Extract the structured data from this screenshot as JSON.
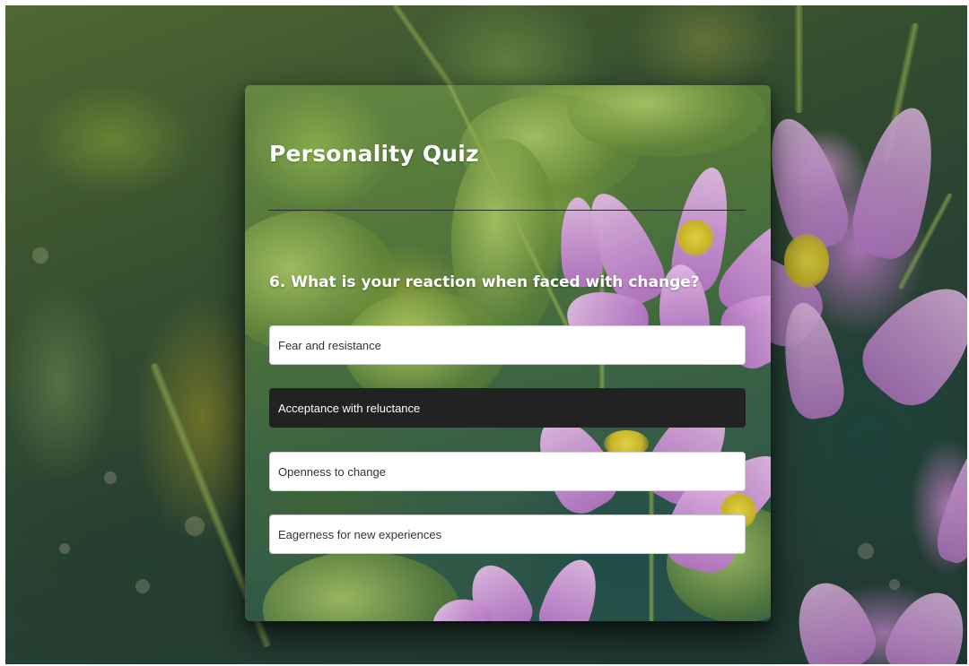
{
  "quiz": {
    "title": "Personality Quiz",
    "question": "6. What is your reaction when faced with change?",
    "options": [
      {
        "label": "Fear and resistance",
        "selected": false
      },
      {
        "label": "Acceptance with reluctance",
        "selected": true
      },
      {
        "label": "Openness to change",
        "selected": false
      },
      {
        "label": "Eagerness for new experiences",
        "selected": false
      }
    ]
  },
  "colors": {
    "option_background": "#ffffff",
    "option_selected_background": "#222222",
    "title_text": "#ffffff"
  }
}
